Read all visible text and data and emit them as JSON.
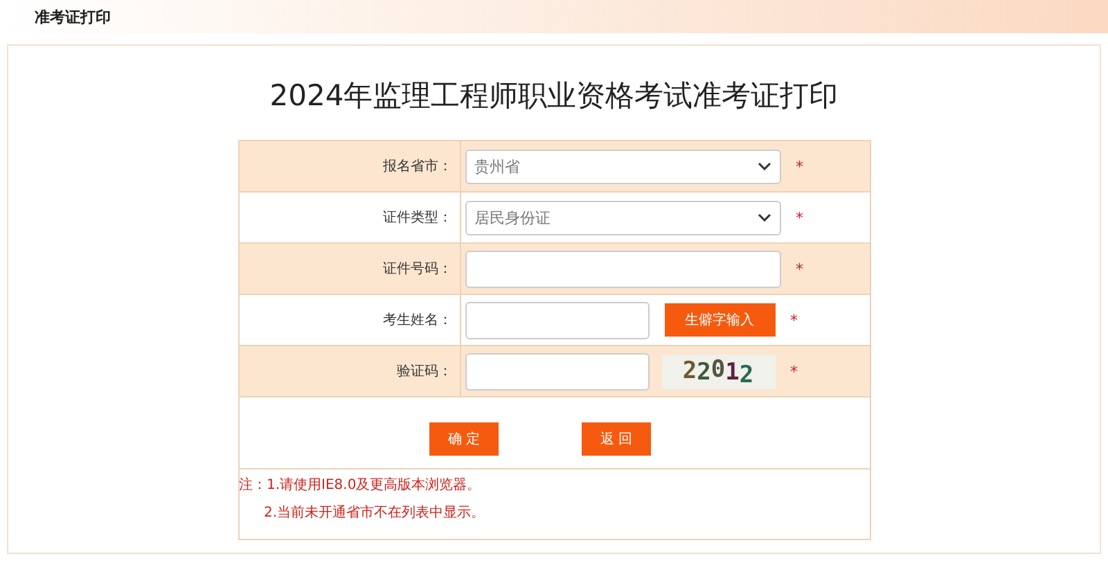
{
  "header": {
    "title": "准考证打印"
  },
  "page_title": "2024年监理工程师职业资格考试准考证打印",
  "fields": [
    {
      "kind": "select",
      "label": "报名省市：",
      "value": "贵州省",
      "required": "*"
    },
    {
      "kind": "select",
      "label": "证件类型：",
      "value": "居民身份证",
      "required": "*"
    },
    {
      "kind": "input",
      "label": "证件号码：",
      "required": "*"
    },
    {
      "kind": "input-button",
      "label": "考生姓名：",
      "button": "生僻字输入",
      "required": "*"
    },
    {
      "kind": "captcha",
      "label": "验证码：",
      "captcha": "22012",
      "required": "*"
    }
  ],
  "buttons": [
    "确 定",
    "返 回"
  ],
  "notes": [
    "注：1.请使用IE8.0及更高版本浏览器。",
    "2.当前未开通省市不在列表中显示。"
  ]
}
